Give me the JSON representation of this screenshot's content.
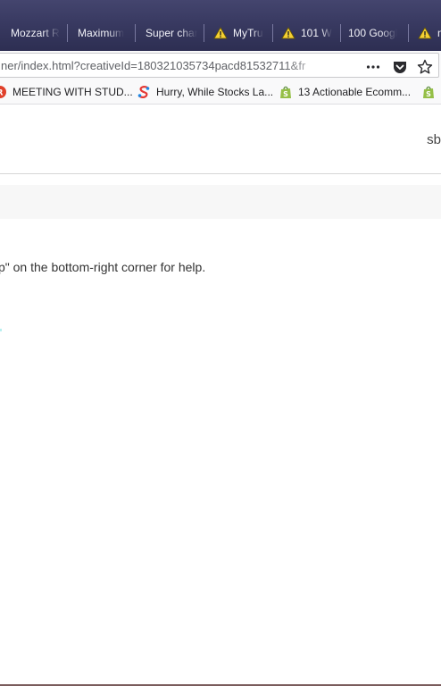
{
  "tabs": [
    {
      "label": "Mozzart R",
      "warning": false
    },
    {
      "label": "Maximum",
      "warning": false
    },
    {
      "label": "Super char",
      "warning": false
    },
    {
      "label": "MyTru",
      "warning": true
    },
    {
      "label": "101 W",
      "warning": true
    },
    {
      "label": "100 Googl",
      "warning": false
    },
    {
      "label": "n",
      "warning": true
    }
  ],
  "navbar": {
    "url": "ner/index.html?creativeId=180321035734pacd81532711&fr",
    "more_icon": "ellipsis-icon",
    "pocket_icon": "pocket-icon",
    "star_icon": "bookmark-star-icon"
  },
  "bookmarks": [
    {
      "label": "MEETING WITH STUD...",
      "icon": "red-circle-icon"
    },
    {
      "label": "Hurry, While Stocks La...",
      "icon": "colorful-s-icon"
    },
    {
      "label": "13 Actionable Ecomm...",
      "icon": "shopify-bag-icon"
    },
    {
      "label": "",
      "icon": "shopify-bag-icon"
    }
  ],
  "page": {
    "header_right_text": "sb",
    "help_text": "p\" on the bottom-right corner for help."
  }
}
